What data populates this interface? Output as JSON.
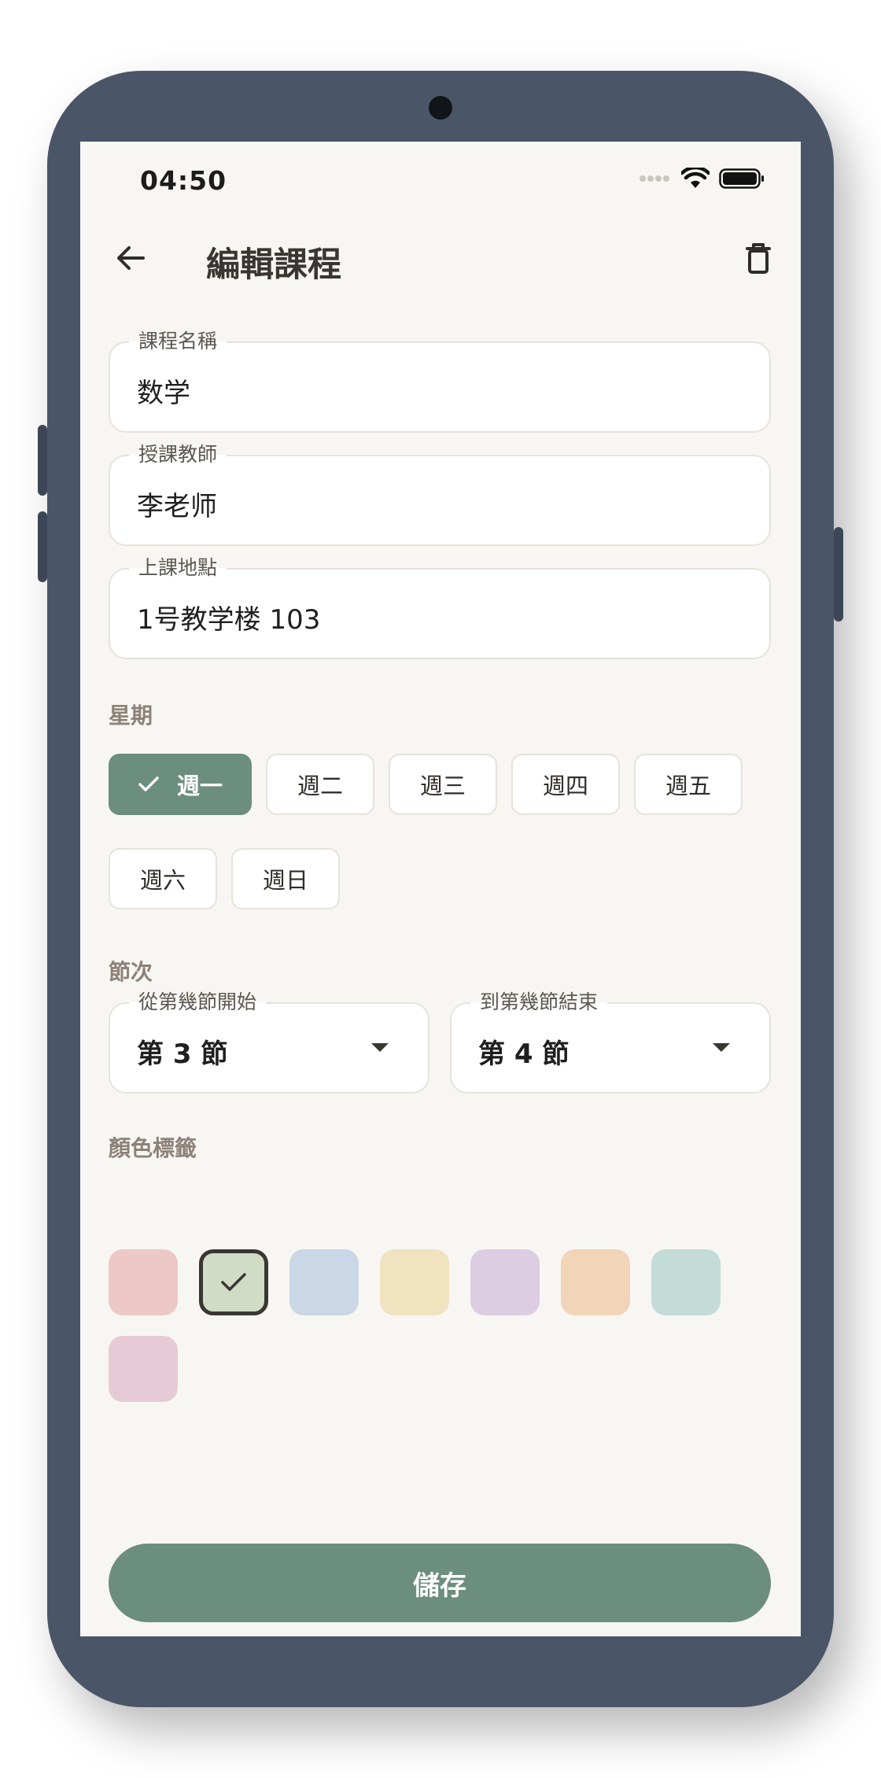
{
  "status_bar": {
    "time": "04:50"
  },
  "appbar": {
    "title": "編輯課程"
  },
  "fields": {
    "course_name": {
      "label": "課程名稱",
      "value": "数学"
    },
    "teacher": {
      "label": "授課教師",
      "value": "李老师"
    },
    "location": {
      "label": "上課地點",
      "value": "1号教学楼 103"
    }
  },
  "weekday": {
    "title": "星期",
    "days": [
      "週一",
      "週二",
      "週三",
      "週四",
      "週五",
      "週六",
      "週日"
    ],
    "selected": "週一"
  },
  "period": {
    "title": "節次",
    "start": {
      "label": "從第幾節開始",
      "value": "第 3 節"
    },
    "end": {
      "label": "到第幾節結束",
      "value": "第 4 節"
    }
  },
  "color_tag": {
    "title": "顏色標籤",
    "colors": [
      "#ecc9c6",
      "#d0dcc4",
      "#c9d7e6",
      "#f1e2c0",
      "#dccde3",
      "#f2d4b9",
      "#c3dcd8",
      "#e6cbd6"
    ],
    "selected_index": 1
  },
  "save_label": "儲存"
}
